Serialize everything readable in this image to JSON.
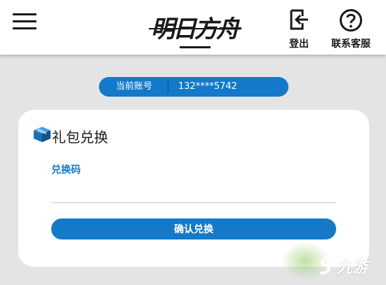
{
  "header": {
    "logo_text": "明日方舟",
    "logout_label": "登出",
    "support_label": "联系客服"
  },
  "account": {
    "label": "当前账号",
    "value": "132****5742"
  },
  "redeem": {
    "title": "礼包兑换",
    "code_label": "兑换码",
    "code_value": "",
    "confirm_label": "确认兑换"
  },
  "watermark": {
    "text": "九游"
  },
  "colors": {
    "accent": "#1479c9",
    "background": "#e4e4e6",
    "card": "#ffffff"
  },
  "icons": [
    "menu-icon",
    "logout-icon",
    "question-icon",
    "gift-box-icon"
  ]
}
